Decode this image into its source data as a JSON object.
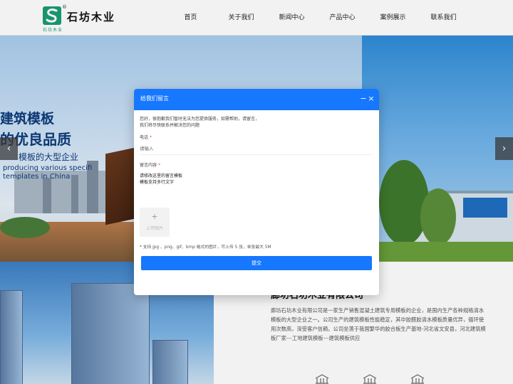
{
  "brand": {
    "name": "石坊木业",
    "registered_mark": "®",
    "subtitle": "石坊木业"
  },
  "nav": {
    "items": [
      {
        "label": "首页"
      },
      {
        "label": "关于我们"
      },
      {
        "label": "新闻中心"
      },
      {
        "label": "产品中心"
      },
      {
        "label": "案例展示"
      },
      {
        "label": "联系我们"
      }
    ]
  },
  "banner": {
    "title_line1": "建筑模板",
    "title_line2": "的优良品质",
    "subtitle": "模板的大型企业",
    "english_line1": "producing various specifi",
    "english_line2": "templates in China",
    "prev_arrow": "‹",
    "next_arrow": "›"
  },
  "about": {
    "title": "廊坊石坊木业有限公司",
    "description": "廊坊石坊木业有限公司是一家生产销售混凝土建筑专用模板的企业，是国内生产各种规格清水模板的大型企业之一。公司生产的建筑模板性能稳定，其中胶醛胶清水模板质量优异，循环使用次数高，深受客户信赖。公司坐落于我国繁华的胶合板生产基地-河北省文安县，河北建筑模板厂家---工地建筑模板---建筑模板供应"
  },
  "dialog": {
    "title": "给我们留言",
    "minimize_label": "−",
    "close_label": "×",
    "greeting_line1": "您好，很抱歉我们暂时无法为您提供服务，如需帮助，请留言，",
    "greeting_line2": "我们将尽快联系并解决您的问题",
    "phone_label": "电话",
    "phone_placeholder": "请输入",
    "message_label": "留言内容",
    "message_placeholder": "请修改这里的留言模板\n模板支持多行文字",
    "required_mark": "*",
    "upload_plus": "+",
    "upload_label": "上传图片",
    "upload_hint": "* 支持 jpg 、png、gif、bmp 格式的图片，可上传 5 张，单张最大 5M",
    "submit_label": "提交"
  },
  "colors": {
    "primary": "#1677ff",
    "brand_green": "#1a9c74",
    "banner_text": "#0d3b7a"
  }
}
